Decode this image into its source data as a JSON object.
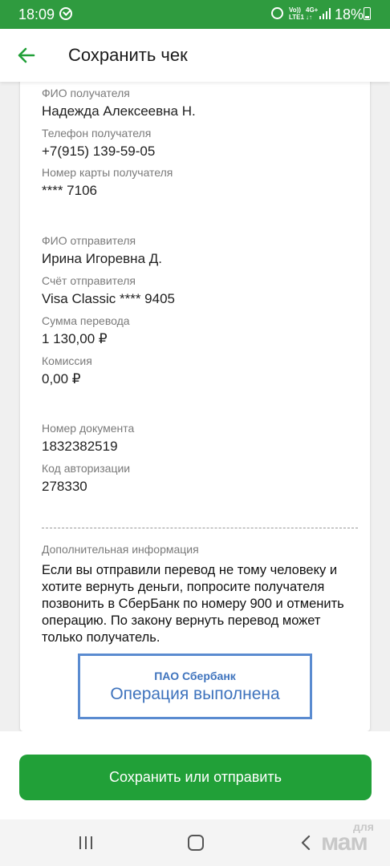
{
  "status_bar": {
    "time": "18:09",
    "network_top": "Vo))",
    "network_bottom": "LTE1",
    "network2_top": "4G+",
    "network2_bottom": "↓↑",
    "battery": "18%"
  },
  "header": {
    "title": "Сохранить чек",
    "back_icon": "arrow-left-icon"
  },
  "receipt": {
    "recipient_name_label": "ФИО получателя",
    "recipient_name": "Надежда Алексеевна Н.",
    "recipient_phone_label": "Телефон получателя",
    "recipient_phone": "+7(915) 139-59-05",
    "recipient_card_label": "Номер карты получателя",
    "recipient_card": "**** 7106",
    "sender_name_label": "ФИО отправителя",
    "sender_name": "Ирина Игоревна Д.",
    "sender_account_label": "Счёт отправителя",
    "sender_account": "Visa Classic **** 9405",
    "amount_label": "Сумма перевода",
    "amount": "1 130,00 ₽",
    "fee_label": "Комиссия",
    "fee": "0,00 ₽",
    "doc_number_label": "Номер документа",
    "doc_number": "1832382519",
    "auth_code_label": "Код авторизации",
    "auth_code": "278330",
    "additional_info_label": "Дополнительная информация",
    "additional_info": "Если вы отправили перевод не тому человеку и хотите вернуть деньги, попросите получателя позвонить в СберБанк по номеру 900 и отменить операцию. По закону вернуть перевод может только получатель."
  },
  "stamp": {
    "bank": "ПАО Сбербанк",
    "status": "Операция выполнена",
    "color": "#3e73bd"
  },
  "actions": {
    "save_label": "Сохранить или отправить",
    "accent_color": "#21a038"
  },
  "watermark": {
    "top": "для",
    "bottom": "мам"
  }
}
